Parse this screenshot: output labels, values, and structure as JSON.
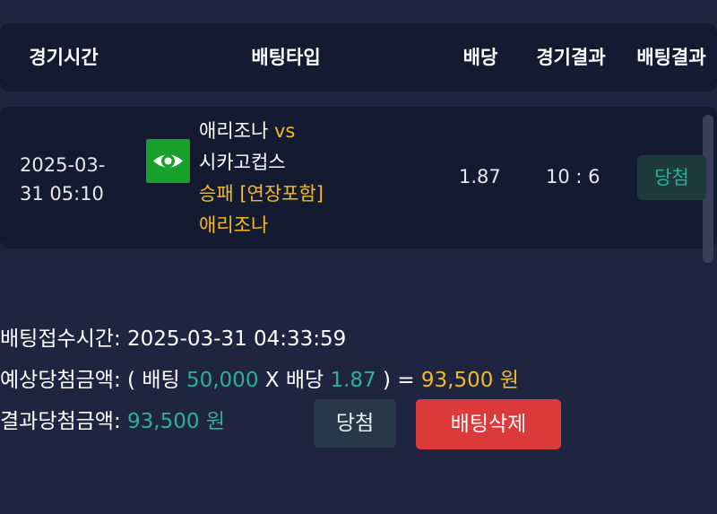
{
  "table_header": {
    "time": "경기시간",
    "bet_type": "배팅타입",
    "odds": "배당",
    "match_result": "경기결과",
    "bet_result": "배팅결과"
  },
  "bet_row": {
    "time_line1": "2025-03-",
    "time_line2": "31 05:10",
    "icon": "eye-icon",
    "home_team": "애리조나",
    "vs": "vs",
    "away_team": "시카고컵스",
    "market": "승패 [연장포함]",
    "pick": "애리조나",
    "odds": "1.87",
    "score": "10 : 6",
    "result": "당첨"
  },
  "summary": {
    "received_label": "배팅접수시간:",
    "received_time": "2025-03-31 04:33:59",
    "expected_label": "예상당첨금액:",
    "open_paren": "(",
    "bet_word": "배팅",
    "bet_amount": "50,000",
    "times": "X",
    "odds_word": "배당",
    "odds_value": "1.87",
    "close_paren": ")",
    "equals": "=",
    "expected_amount": "93,500 원",
    "result_label": "결과당첨금액:",
    "result_amount": "93,500 원"
  },
  "buttons": {
    "win_label": "당첨",
    "delete_label": "배팅삭제"
  },
  "colors": {
    "background": "#1f2540",
    "panel": "#141a30",
    "accent_yellow": "#f3b92b",
    "accent_teal": "#2fae98",
    "delete_red": "#dc3a3a",
    "eye_green": "#17a12c"
  }
}
